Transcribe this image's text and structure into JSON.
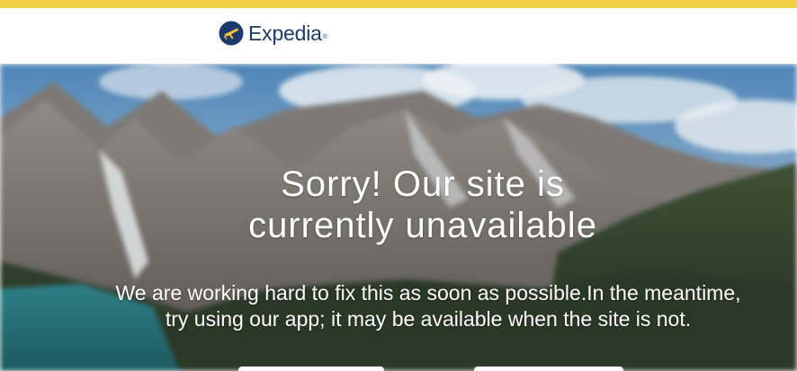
{
  "header": {
    "logo_text": "Expedia",
    "logo_tm": "®",
    "logo_icon": "expedia-globe-plane-icon"
  },
  "main": {
    "headline_line1": "Sorry! Our site is",
    "headline_line2": "currently unavailable",
    "message_line1": "We are working hard to fix this as soon as possible.In the meantime,",
    "message_line2": "try using our app; it may be available when the site is not."
  },
  "colors": {
    "top_stripe": "#f3cc45",
    "brand_navy": "#1b3b6d",
    "brand_yellow": "#fbc23d",
    "text": "#ffffff"
  }
}
